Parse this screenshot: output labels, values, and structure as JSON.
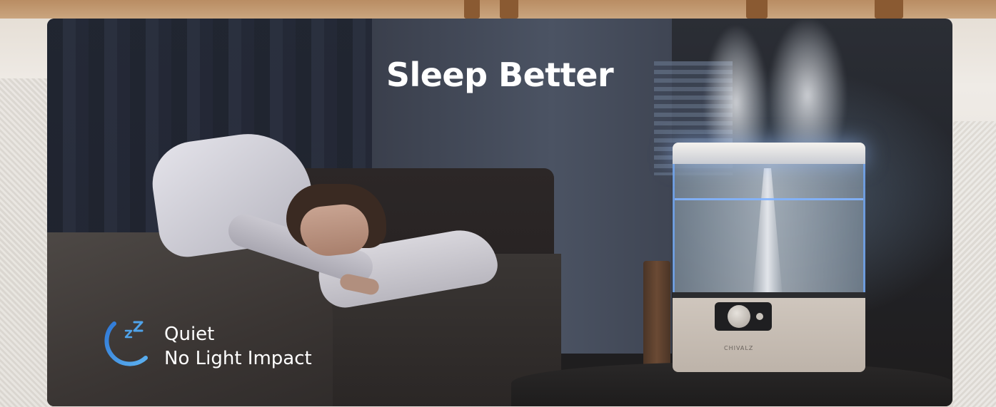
{
  "banner": {
    "title": "Sleep Better",
    "features": {
      "icon": "moon-zzz-icon",
      "line1": "Quiet",
      "line2": "No Light Impact"
    },
    "product_brand": "CHIVALZ"
  },
  "colors": {
    "accent_blue": "#3d8fe0",
    "text": "#ffffff"
  }
}
